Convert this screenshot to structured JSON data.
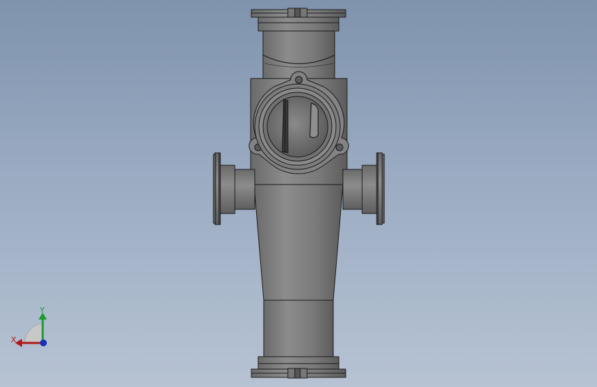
{
  "viewport": {
    "background_top": "#7f93ad",
    "background_bottom": "#b7c3d3"
  },
  "model": {
    "body_color": "#7e7e7e",
    "body_light": "#9a9a9a",
    "body_dark": "#5e5e5e",
    "edge_color": "#1a1a1a"
  },
  "triad": {
    "x_label": "X",
    "y_label": "Y",
    "x_color": "#b01818",
    "y_color": "#1a9a2a",
    "z_color": "#1a2fb8"
  }
}
